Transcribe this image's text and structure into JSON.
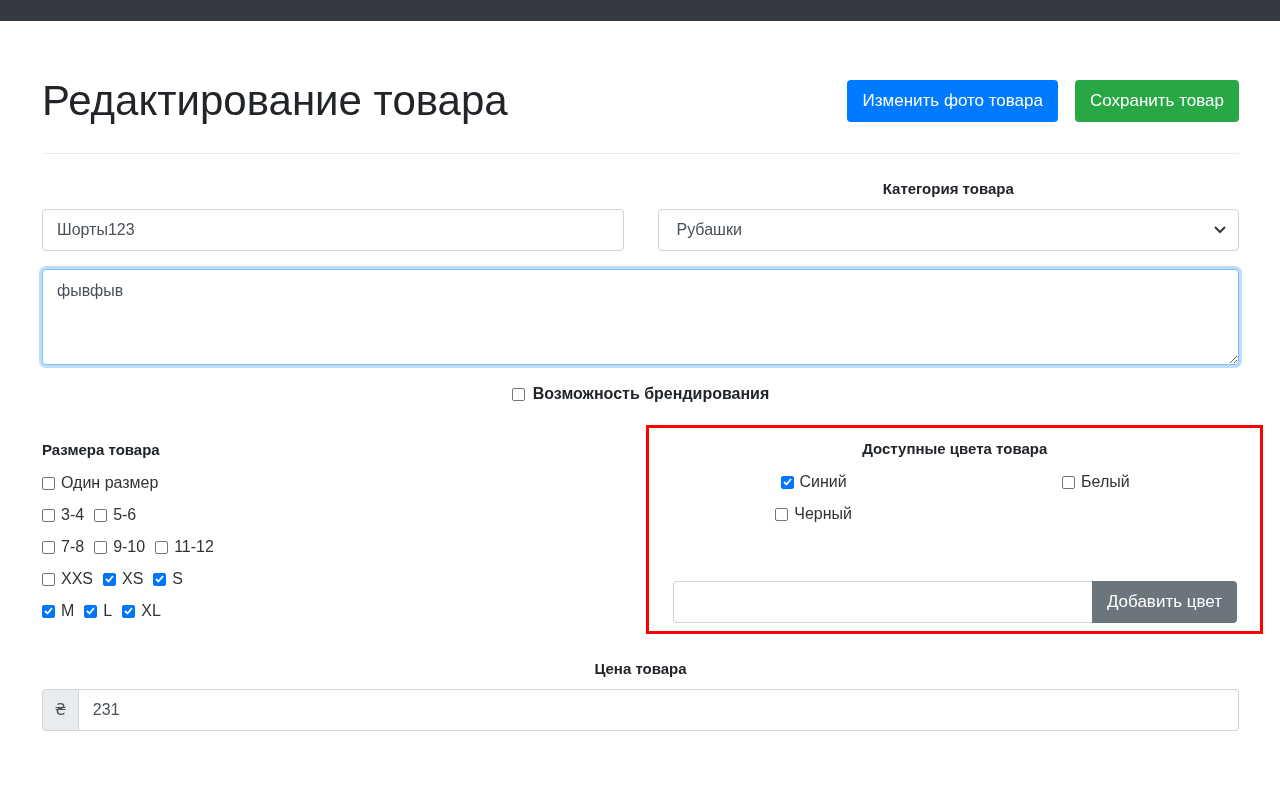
{
  "title": "Редактирование товара",
  "buttons": [
    {
      "label": "Изменить фото товара",
      "kind": "primary"
    },
    {
      "label": "Сохранить товар",
      "kind": "success"
    }
  ],
  "name_field": {
    "value": "Шорты123"
  },
  "category": {
    "label": "Категория товара",
    "value": "Рубашки"
  },
  "description": {
    "value": "фывфыв",
    "focused": true
  },
  "branding": {
    "label": "Возможность брендирования",
    "checked": false
  },
  "sizes": {
    "label": "Размера товара",
    "rows": [
      [
        {
          "label": "Один размер",
          "checked": false
        }
      ],
      [
        {
          "label": "3-4",
          "checked": false
        },
        {
          "label": "5-6",
          "checked": false
        }
      ],
      [
        {
          "label": "7-8",
          "checked": false
        },
        {
          "label": "9-10",
          "checked": false
        },
        {
          "label": "11-12",
          "checked": false
        }
      ],
      [
        {
          "label": "XXS",
          "checked": false
        },
        {
          "label": "XS",
          "checked": true
        },
        {
          "label": "S",
          "checked": true
        }
      ],
      [
        {
          "label": "M",
          "checked": true
        },
        {
          "label": "L",
          "checked": true
        },
        {
          "label": "XL",
          "checked": true
        }
      ]
    ]
  },
  "colors": {
    "label": "Доступные цвета товара",
    "highlighted": true,
    "items": [
      {
        "label": "Синий",
        "checked": true
      },
      {
        "label": "Белый",
        "checked": false
      },
      {
        "label": "Черный",
        "checked": false
      }
    ],
    "add_button": "Добавить цвет"
  },
  "price": {
    "label": "Цена товара",
    "currency": "₴",
    "value": "231"
  }
}
